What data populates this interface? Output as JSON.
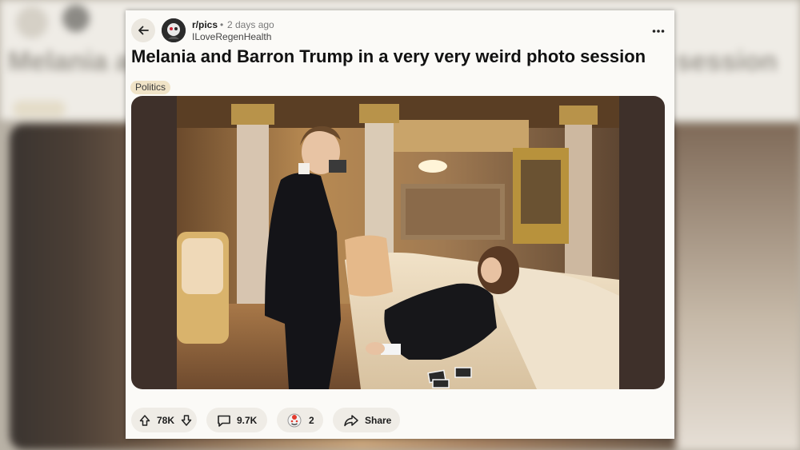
{
  "post": {
    "subreddit": "r/pics",
    "separator": "•",
    "time": "2 days ago",
    "author": "ILoveRegenHealth",
    "title": "Melania and Barron Trump in a very very weird photo session",
    "flair": "Politics"
  },
  "actions": {
    "votes": "78K",
    "comments": "9.7K",
    "awards": "2",
    "share": "Share"
  },
  "background": {
    "title_left": "Melania a",
    "title_right": "session"
  },
  "colors": {
    "card": "#fbfaf7",
    "flair": "#f0e3c7",
    "action_pill": "#efece6"
  },
  "icons": [
    "back-arrow-icon",
    "more-dots-icon",
    "upvote-icon",
    "downvote-icon",
    "comment-icon",
    "award-icon",
    "share-icon"
  ]
}
